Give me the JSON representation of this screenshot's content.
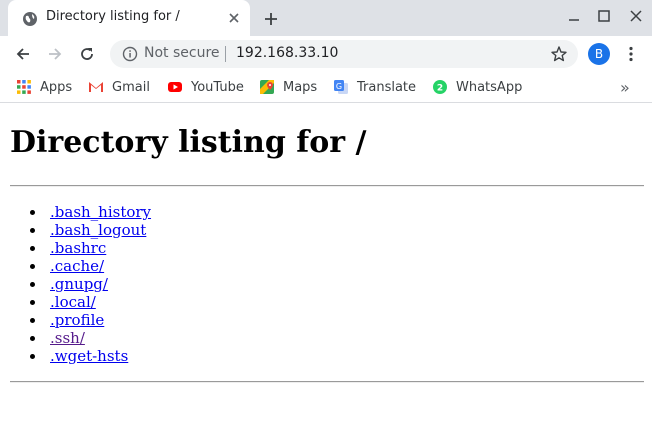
{
  "tab": {
    "title": "Directory listing for /"
  },
  "toolbar": {
    "not_secure": "Not secure",
    "url": "192.168.33.10",
    "profile_initial": "B"
  },
  "bookmarks": [
    {
      "label": "Apps",
      "icon": "apps-grid-icon"
    },
    {
      "label": "Gmail",
      "icon": "gmail-icon"
    },
    {
      "label": "YouTube",
      "icon": "youtube-icon"
    },
    {
      "label": "Maps",
      "icon": "maps-icon"
    },
    {
      "label": "Translate",
      "icon": "translate-icon"
    },
    {
      "label": "WhatsApp",
      "icon": "whatsapp-icon"
    }
  ],
  "page": {
    "heading": "Directory listing for /",
    "entries": [
      {
        "name": ".bash_history",
        "visited": false
      },
      {
        "name": ".bash_logout",
        "visited": false
      },
      {
        "name": ".bashrc",
        "visited": false
      },
      {
        "name": ".cache/",
        "visited": false
      },
      {
        "name": ".gnupg/",
        "visited": false
      },
      {
        "name": ".local/",
        "visited": false
      },
      {
        "name": ".profile",
        "visited": false
      },
      {
        "name": ".ssh/",
        "visited": true
      },
      {
        "name": ".wget-hsts",
        "visited": false
      }
    ]
  },
  "colors": {
    "link": "#0000ee",
    "visited": "#551a8b",
    "profile": "#1a73e8"
  }
}
